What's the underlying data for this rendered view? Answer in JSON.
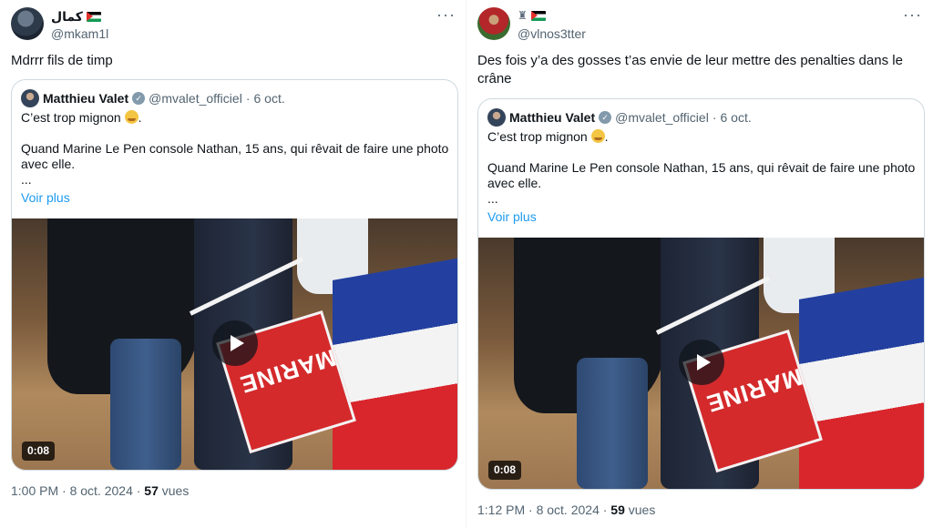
{
  "tweets": [
    {
      "display_name": "كمال",
      "handle": "@mkam1l",
      "more": "···",
      "text": "Mdrrr fils de timp",
      "quote": {
        "name": "Matthieu Valet",
        "handle": "@mvalet_officiel",
        "separator": "·",
        "date": "6 oct.",
        "line1": "C’est trop mignon",
        "line2": "Quand Marine Le Pen console Nathan, 15 ans, qui rêvait de faire une photo avec elle.",
        "ellipsis": "...",
        "see_more": "Voir plus",
        "video": {
          "duration": "0:08",
          "sign_text": "MARINE"
        }
      },
      "footer": {
        "time_date": "1:00 PM · 8 oct. 2024 ·",
        "views": "57",
        "views_label": "vues"
      }
    },
    {
      "display_name": "",
      "handle": "@vlnos3tter",
      "more": "···",
      "text": "Des fois y’a des gosses t’as envie de leur mettre des penalties dans le crâne",
      "quote": {
        "name": "Matthieu Valet",
        "handle": "@mvalet_officiel",
        "separator": "·",
        "date": "6 oct.",
        "line1": "C’est trop mignon",
        "line2": "Quand Marine Le Pen console Nathan, 15 ans, qui rêvait de faire une photo avec elle.",
        "ellipsis": "...",
        "see_more": "Voir plus",
        "video": {
          "duration": "0:08",
          "sign_text": "MARINE"
        }
      },
      "footer": {
        "time_date": "1:12 PM · 8 oct. 2024 ·",
        "views": "59",
        "views_label": "vues"
      }
    }
  ],
  "colors": {
    "link": "#1d9bf0",
    "muted": "#536471",
    "border": "#cfd9de"
  },
  "icons": [
    "palestine-flag-icon",
    "castle-icon",
    "verified-badge-icon",
    "play-icon",
    "more-options-icon",
    "emoji-icon"
  ]
}
